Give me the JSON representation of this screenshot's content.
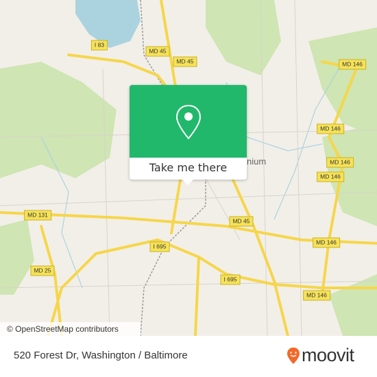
{
  "map": {
    "road_labels": [
      {
        "text": "MD 45",
        "id": "md45-a"
      },
      {
        "text": "I 83",
        "id": "i83"
      },
      {
        "text": "MD 45",
        "id": "md45-b"
      },
      {
        "text": "MD 146",
        "id": "md146-a"
      },
      {
        "text": "MD 146",
        "id": "md146-b"
      },
      {
        "text": "MD 146",
        "id": "md146-c"
      },
      {
        "text": "MD 146",
        "id": "md146-d"
      },
      {
        "text": "MD 45",
        "id": "md45-c"
      },
      {
        "text": "MD 131",
        "id": "md131"
      },
      {
        "text": "I 695",
        "id": "i695-a"
      },
      {
        "text": "MD 146",
        "id": "md146-e"
      },
      {
        "text": "MD 25",
        "id": "md25"
      },
      {
        "text": "I 695",
        "id": "i695-b"
      },
      {
        "text": "MD 146",
        "id": "md146-f"
      }
    ],
    "place_label": "nium",
    "attribution": "© OpenStreetMap contributors",
    "colors": {
      "land": "#f2efe9",
      "water": "#aad3df",
      "park": "#c8e1a8",
      "highway": "#f6d64a",
      "popup": "#21b86c",
      "brand": "#f26a2b"
    }
  },
  "popup": {
    "icon": "map-pin-icon",
    "button_label": "Take me there"
  },
  "footer": {
    "address": "520 Forest Dr, Washington / Baltimore",
    "brand": "moovit"
  }
}
